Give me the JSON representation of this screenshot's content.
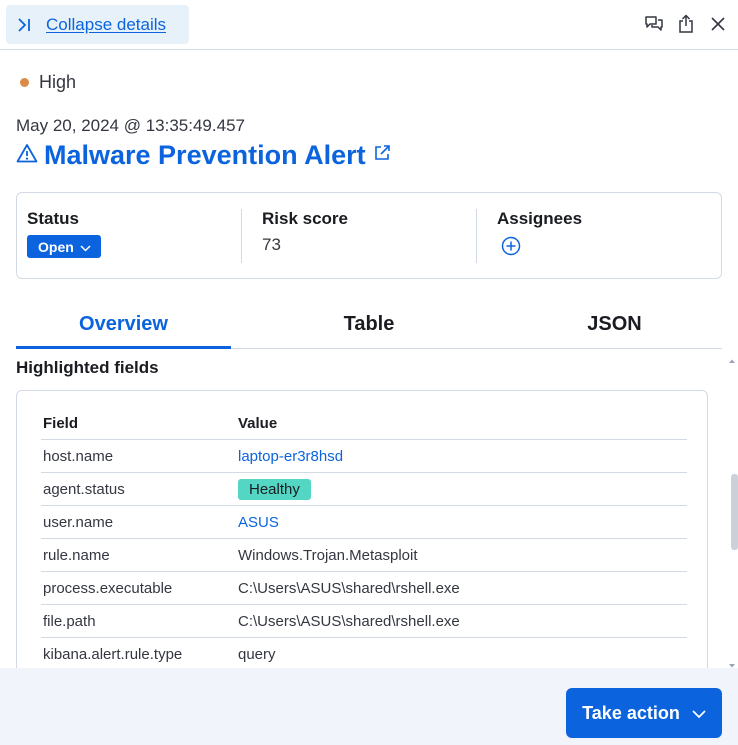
{
  "topbar": {
    "collapse_label": "Collapse details",
    "icons": [
      "collapse-icon",
      "discuss-icon",
      "share-icon",
      "close-icon"
    ]
  },
  "header": {
    "severity": "High",
    "severity_color": "#da8b45",
    "timestamp": "May 20, 2024 @ 13:35:49.457",
    "title": "Malware Prevention Alert"
  },
  "status_panel": {
    "status_title": "Status",
    "status_value": "Open",
    "risk_title": "Risk score",
    "risk_value": "73",
    "assignees_title": "Assignees"
  },
  "tabs": [
    {
      "label": "Overview",
      "active": true
    },
    {
      "label": "Table",
      "active": false
    },
    {
      "label": "JSON",
      "active": false
    }
  ],
  "highlighted": {
    "title": "Highlighted fields",
    "columns": [
      "Field",
      "Value"
    ],
    "rows": [
      {
        "field": "host.name",
        "value": "laptop-er3r8hsd",
        "type": "link"
      },
      {
        "field": "agent.status",
        "value": "Healthy",
        "type": "badge"
      },
      {
        "field": "user.name",
        "value": "ASUS",
        "type": "link"
      },
      {
        "field": "rule.name",
        "value": "Windows.Trojan.Metasploit",
        "type": "text"
      },
      {
        "field": "process.executable",
        "value": "C:\\Users\\ASUS\\shared\\rshell.exe",
        "type": "text"
      },
      {
        "field": "file.path",
        "value": "C:\\Users\\ASUS\\shared\\rshell.exe",
        "type": "text"
      },
      {
        "field": "kibana.alert.rule.type",
        "value": "query",
        "type": "text"
      }
    ]
  },
  "footer": {
    "take_action_label": "Take action"
  },
  "colors": {
    "accent": "#0b64dd",
    "healthy": "#54d6c4",
    "footer_bg": "#f1f4fa"
  }
}
